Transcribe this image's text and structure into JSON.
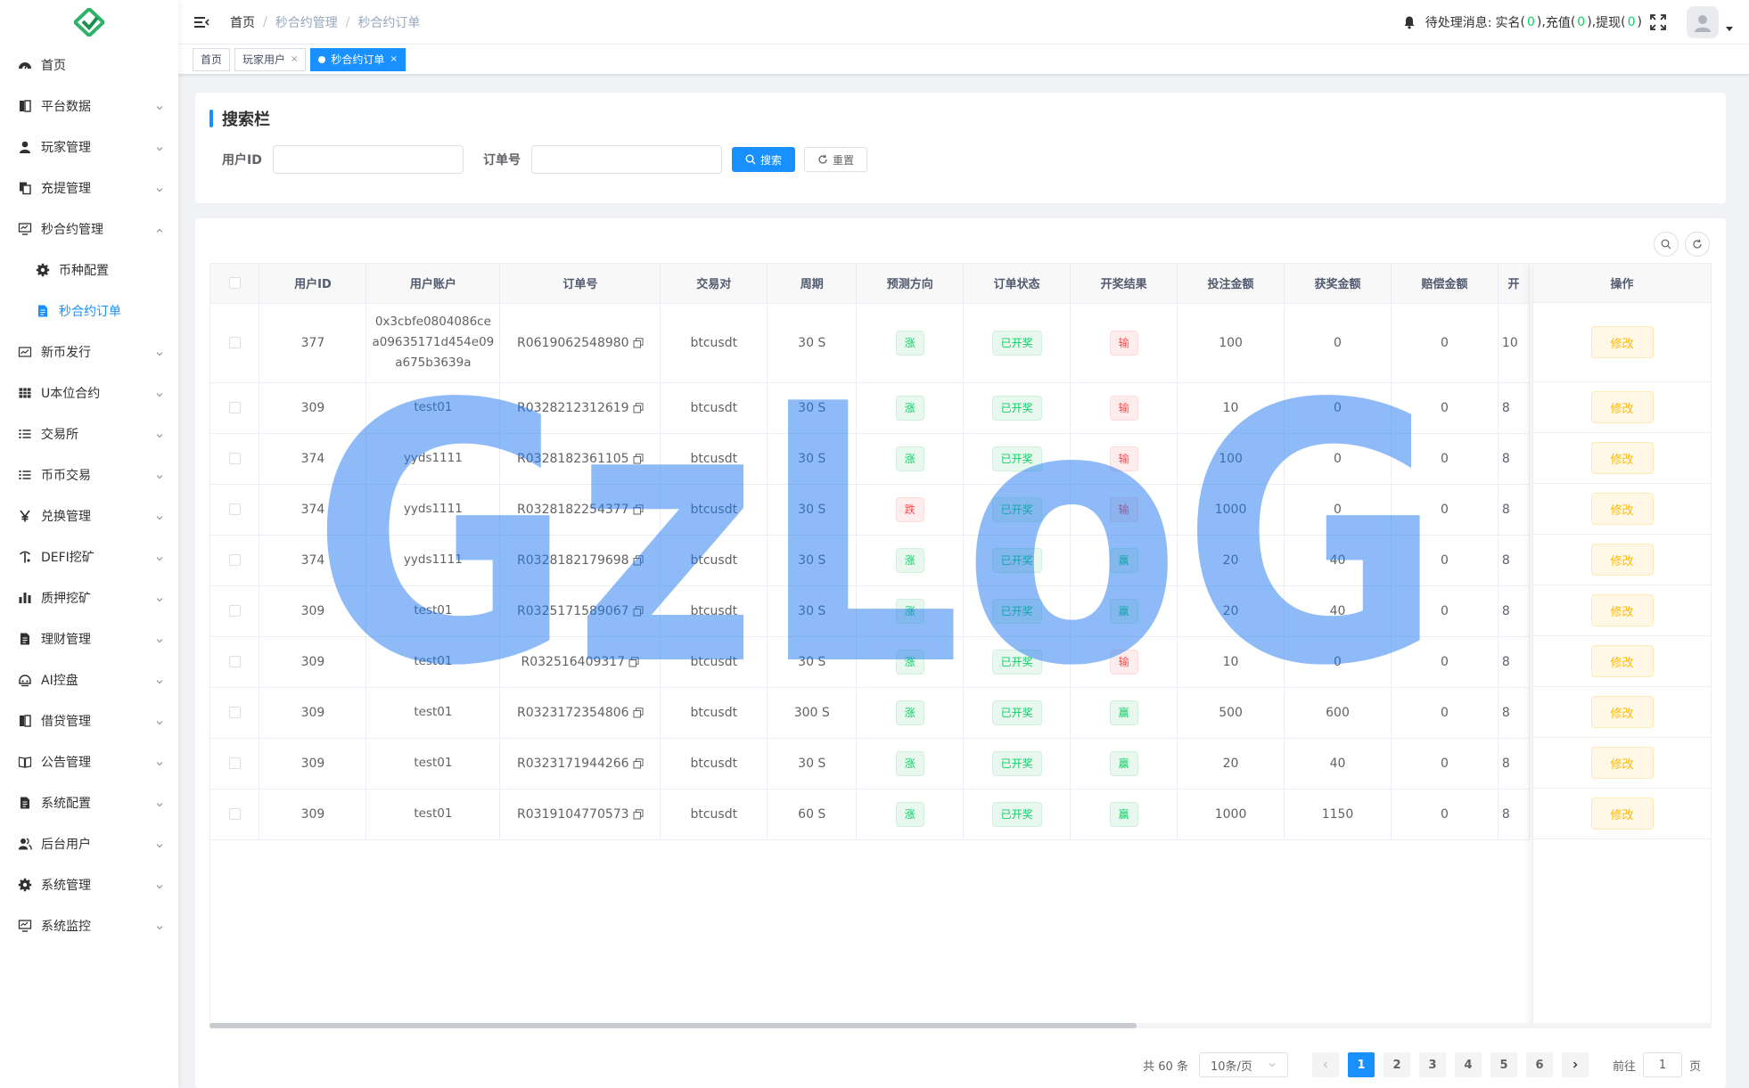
{
  "sidebar": {
    "items": [
      {
        "label": "首页",
        "icon": "dashboard-icon",
        "expandable": false
      },
      {
        "label": "平台数据",
        "icon": "book-icon",
        "expandable": true
      },
      {
        "label": "玩家管理",
        "icon": "user-icon",
        "expandable": true
      },
      {
        "label": "充提管理",
        "icon": "copy-icon",
        "expandable": true
      },
      {
        "label": "秒合约管理",
        "icon": "monitor-icon",
        "expandable": true,
        "expanded": true
      },
      {
        "label": "币种配置",
        "icon": "gear-icon",
        "expandable": false,
        "sub": true
      },
      {
        "label": "秒合约订单",
        "icon": "document-icon",
        "expandable": false,
        "sub": true,
        "active": true
      },
      {
        "label": "新币发行",
        "icon": "chart-icon",
        "expandable": true
      },
      {
        "label": "U本位合约",
        "icon": "table-icon",
        "expandable": true
      },
      {
        "label": "交易所",
        "icon": "list-icon",
        "expandable": true
      },
      {
        "label": "币币交易",
        "icon": "list-icon",
        "expandable": true
      },
      {
        "label": "兑换管理",
        "icon": "yen-icon",
        "expandable": true
      },
      {
        "label": "DEFI挖矿",
        "icon": "pick-icon",
        "expandable": true
      },
      {
        "label": "质押挖矿",
        "icon": "bar-chart-icon",
        "expandable": true
      },
      {
        "label": "理财管理",
        "icon": "document-icon",
        "expandable": true
      },
      {
        "label": "AI控盘",
        "icon": "robot-icon",
        "expandable": true
      },
      {
        "label": "借贷管理",
        "icon": "book-icon",
        "expandable": true
      },
      {
        "label": "公告管理",
        "icon": "open-book-icon",
        "expandable": true
      },
      {
        "label": "系统配置",
        "icon": "document-icon",
        "expandable": true
      },
      {
        "label": "后台用户",
        "icon": "users-icon",
        "expandable": true
      },
      {
        "label": "系统管理",
        "icon": "gear-icon",
        "expandable": true
      },
      {
        "label": "系统监控",
        "icon": "monitor-icon",
        "expandable": true
      }
    ]
  },
  "navbar": {
    "breadcrumb": [
      "首页",
      "秒合约管理",
      "秒合约订单"
    ],
    "message_prefix": "待处理消息:",
    "msg_items": [
      {
        "label": "实名",
        "count": "0"
      },
      {
        "label": "充值",
        "count": "0"
      },
      {
        "label": "提现",
        "count": "0"
      }
    ]
  },
  "tags": [
    {
      "label": "首页",
      "closable": false,
      "active": false
    },
    {
      "label": "玩家用户",
      "closable": true,
      "active": false
    },
    {
      "label": "秒合约订单",
      "closable": true,
      "active": true
    }
  ],
  "search": {
    "title": "搜索栏",
    "user_id_label": "用户ID",
    "order_no_label": "订单号",
    "search_button": "搜索",
    "reset_button": "重置"
  },
  "table": {
    "columns": [
      "用户ID",
      "用户账户",
      "订单号",
      "交易对",
      "周期",
      "预测方向",
      "订单状态",
      "开奖结果",
      "投注金额",
      "获奖金额",
      "赔偿金额",
      "开"
    ],
    "action_header": "操作",
    "action_label": "修改",
    "rows": [
      {
        "user_id": "377",
        "account": "0x3cbfe0804086cea09635171d454e09a675b3639a",
        "order_no": "R0619062548980",
        "pair": "btcusdt",
        "period": "30 S",
        "direction": "涨",
        "status": "已开奖",
        "result": "输",
        "bet": "100",
        "win": "0",
        "comp": "0",
        "extra": "10"
      },
      {
        "user_id": "309",
        "account": "test01",
        "order_no": "R0328212312619",
        "pair": "btcusdt",
        "period": "30 S",
        "direction": "涨",
        "status": "已开奖",
        "result": "输",
        "bet": "10",
        "win": "0",
        "comp": "0",
        "extra": "8"
      },
      {
        "user_id": "374",
        "account": "yyds1111",
        "order_no": "R0328182361105",
        "pair": "btcusdt",
        "period": "30 S",
        "direction": "涨",
        "status": "已开奖",
        "result": "输",
        "bet": "100",
        "win": "0",
        "comp": "0",
        "extra": "8"
      },
      {
        "user_id": "374",
        "account": "yyds1111",
        "order_no": "R0328182254377",
        "pair": "btcusdt",
        "period": "30 S",
        "direction": "跌",
        "status": "已开奖",
        "result": "输",
        "bet": "1000",
        "win": "0",
        "comp": "0",
        "extra": "8"
      },
      {
        "user_id": "374",
        "account": "yyds1111",
        "order_no": "R0328182179698",
        "pair": "btcusdt",
        "period": "30 S",
        "direction": "涨",
        "status": "已开奖",
        "result": "赢",
        "bet": "20",
        "win": "40",
        "comp": "0",
        "extra": "8"
      },
      {
        "user_id": "309",
        "account": "test01",
        "order_no": "R0325171589067",
        "pair": "btcusdt",
        "period": "30 S",
        "direction": "涨",
        "status": "已开奖",
        "result": "赢",
        "bet": "20",
        "win": "40",
        "comp": "0",
        "extra": "8"
      },
      {
        "user_id": "309",
        "account": "test01",
        "order_no": "R032516409317",
        "pair": "btcusdt",
        "period": "30 S",
        "direction": "涨",
        "status": "已开奖",
        "result": "输",
        "bet": "10",
        "win": "0",
        "comp": "0",
        "extra": "8"
      },
      {
        "user_id": "309",
        "account": "test01",
        "order_no": "R0323172354806",
        "pair": "btcusdt",
        "period": "300 S",
        "direction": "涨",
        "status": "已开奖",
        "result": "赢",
        "bet": "500",
        "win": "600",
        "comp": "0",
        "extra": "8"
      },
      {
        "user_id": "309",
        "account": "test01",
        "order_no": "R0323171944266",
        "pair": "btcusdt",
        "period": "30 S",
        "direction": "涨",
        "status": "已开奖",
        "result": "赢",
        "bet": "20",
        "win": "40",
        "comp": "0",
        "extra": "8"
      },
      {
        "user_id": "309",
        "account": "test01",
        "order_no": "R0319104770573",
        "pair": "btcusdt",
        "period": "60 S",
        "direction": "涨",
        "status": "已开奖",
        "result": "赢",
        "bet": "1000",
        "win": "1150",
        "comp": "0",
        "extra": "8"
      }
    ]
  },
  "pagination": {
    "total": "共 60 条",
    "page_size": "10条/页",
    "pages": [
      "1",
      "2",
      "3",
      "4",
      "5",
      "6"
    ],
    "current": "1",
    "goto_label": "前往",
    "goto_value": "1",
    "page_unit": "页"
  },
  "watermark": "GzLoG",
  "colors": {
    "primary": "#1890ff",
    "success": "#13ce66",
    "danger": "#ff4949",
    "warning": "#ffba00",
    "watermark": "#1e78f0"
  }
}
